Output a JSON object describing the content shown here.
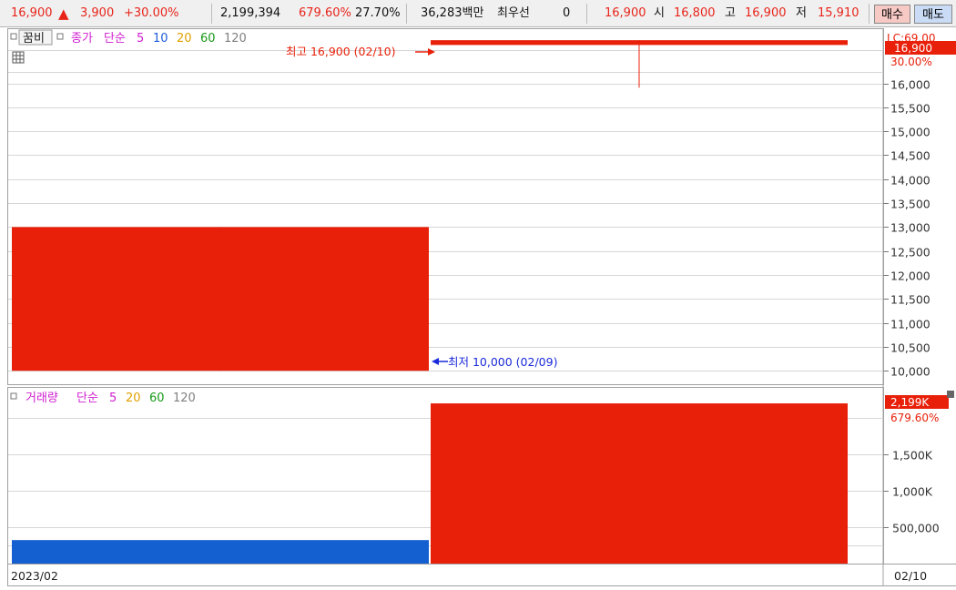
{
  "ticker_bar": {
    "price": "16,900",
    "change": "3,900",
    "change_pct": "+30.00%",
    "volume": "2,199,394",
    "volume_ratio": "679.60%",
    "turnover": "27.70%",
    "amount": "36,283백만",
    "best_bid_label": "최우선",
    "best_bid_value": "0",
    "current": "16,900",
    "open_label": "시",
    "open_value": "16,800",
    "high_label": "고",
    "high_value": "16,900",
    "low_label": "저",
    "low_value": "15,910",
    "buy_label": "매수",
    "sell_label": "매도"
  },
  "price_panel": {
    "checkbox_label": "꿈비",
    "series_label": "종가",
    "ma_label": "단순",
    "ma_periods": [
      "5",
      "10",
      "20",
      "60",
      "120"
    ],
    "ma_colors": [
      "#d01fd0",
      "#1f5cd8",
      "#e0a000",
      "#1a9a1a",
      "#808080"
    ],
    "high_annotation": "최고 16,900 (02/10)",
    "low_annotation": "최저 10,000 (02/09)",
    "current_tag": "16,900",
    "pct_tag": "30.00%",
    "lc_tag": "LC:69.00"
  },
  "volume_panel": {
    "series_label": "거래량",
    "ma_label": "단순",
    "ma_periods": [
      "5",
      "20",
      "60",
      "120"
    ],
    "ma_colors": [
      "#d01fd0",
      "#e0a000",
      "#1a9a1a",
      "#808080"
    ],
    "current_tag": "2,199K",
    "pct_tag": "679.60%"
  },
  "footer": {
    "left_date": "2023/02",
    "right_date": "02/10"
  },
  "chart_data": [
    {
      "type": "bar",
      "title": "",
      "categories": [
        "02/09",
        "02/10"
      ],
      "candles": [
        {
          "date": "02/09",
          "open": 13000,
          "close": 10000,
          "high": 13000,
          "low": 10000,
          "color": "#e8200a"
        },
        {
          "date": "02/10",
          "open": 16800,
          "close": 16900,
          "high": 16900,
          "low": 15910,
          "color": "#e8200a"
        }
      ],
      "ylim": [
        9700,
        17150
      ],
      "yticks": [
        "10,000",
        "10,500",
        "11,000",
        "11,500",
        "12,000",
        "12,500",
        "13,000",
        "13,500",
        "14,000",
        "14,500",
        "15,000",
        "15,500",
        "16,000"
      ]
    },
    {
      "type": "bar",
      "title": "",
      "categories": [
        "02/09",
        "02/10"
      ],
      "values": [
        323000,
        2199394
      ],
      "colors": [
        "#1560d0",
        "#e8200a"
      ],
      "ylim": [
        0,
        2200000
      ],
      "yticks": [
        "500,000",
        "1,000K",
        "1,500K"
      ]
    }
  ]
}
